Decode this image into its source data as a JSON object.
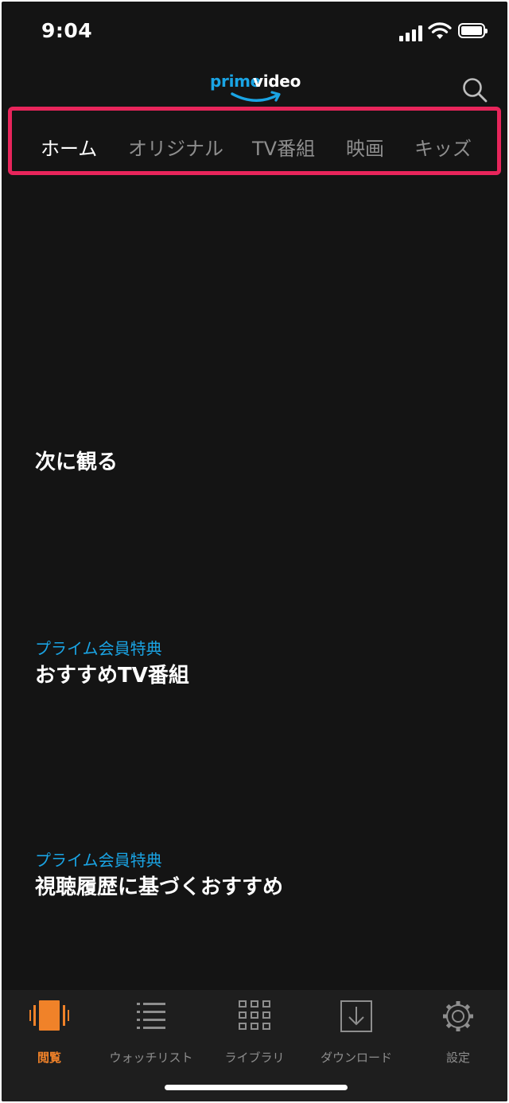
{
  "status_bar": {
    "time": "9:04"
  },
  "header": {
    "logo_text_prime": "prime",
    "logo_text_video": "video"
  },
  "tabs": [
    {
      "label": "ホーム",
      "active": true
    },
    {
      "label": "オリジナル",
      "active": false
    },
    {
      "label": "TV番組",
      "active": false
    },
    {
      "label": "映画",
      "active": false
    },
    {
      "label": "キッズ",
      "active": false
    }
  ],
  "sections": [
    {
      "subtitle": "",
      "title": "次に観る"
    },
    {
      "subtitle": "プライム会員特典",
      "title": "おすすめTV番組"
    },
    {
      "subtitle": "プライム会員特典",
      "title": "視聴履歴に基づくおすすめ"
    }
  ],
  "bottom_nav": [
    {
      "label": "閲覧",
      "icon": "browse-icon",
      "active": true
    },
    {
      "label": "ウォッチリスト",
      "icon": "watchlist-icon",
      "active": false
    },
    {
      "label": "ライブラリ",
      "icon": "library-icon",
      "active": false
    },
    {
      "label": "ダウンロード",
      "icon": "download-icon",
      "active": false
    },
    {
      "label": "設定",
      "icon": "gear-icon",
      "active": false
    }
  ],
  "colors": {
    "accent_blue": "#1aa4e4",
    "active_orange": "#f08229",
    "highlight_border": "#e8255b",
    "background": "#141414"
  }
}
